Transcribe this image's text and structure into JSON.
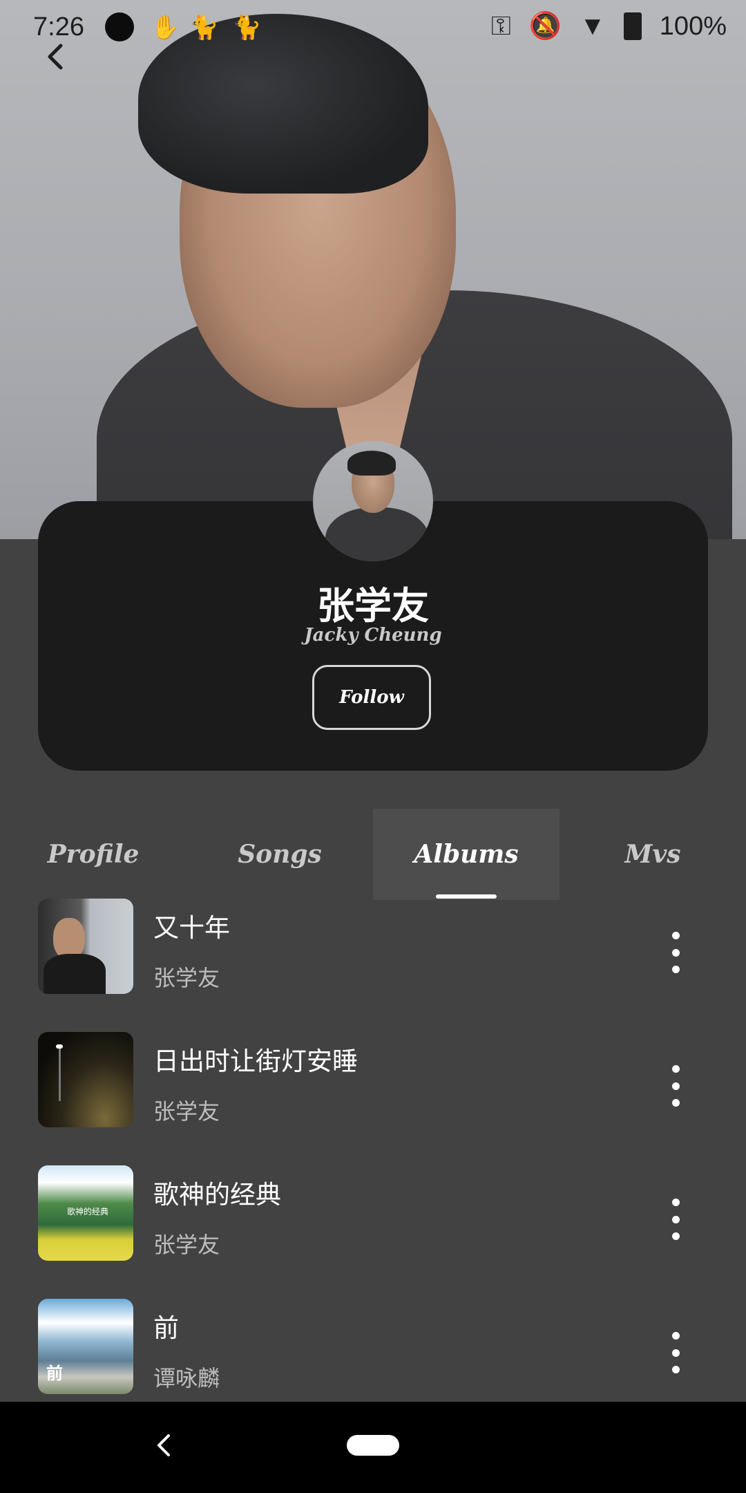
{
  "status_bar": {
    "time": "7:26",
    "battery": "100%",
    "icons": [
      "circle-icon",
      "hand-icon",
      "cat-icon",
      "cat-icon",
      "key-icon",
      "bell-off-icon",
      "wifi-icon",
      "battery-charging-icon"
    ]
  },
  "artist": {
    "name": "张学友",
    "english_name": "Jacky Cheung",
    "follow_label": "Follow"
  },
  "tabs": [
    {
      "label": "Profile"
    },
    {
      "label": "Songs"
    },
    {
      "label": "Albums"
    },
    {
      "label": "Mvs"
    }
  ],
  "active_tab": "Albums",
  "albums": [
    {
      "title": "又十年",
      "artist": "张学友"
    },
    {
      "title": "日出时让街灯安睡",
      "artist": "张学友"
    },
    {
      "title": "歌神的经典",
      "artist": "张学友",
      "cover_text": "歌神的经典"
    },
    {
      "title": "前",
      "artist": "谭咏麟",
      "cover_text": "前"
    }
  ],
  "colors": {
    "background": "#424242",
    "card": "#1b1b1b",
    "active_tab": "#4d4d4d"
  }
}
